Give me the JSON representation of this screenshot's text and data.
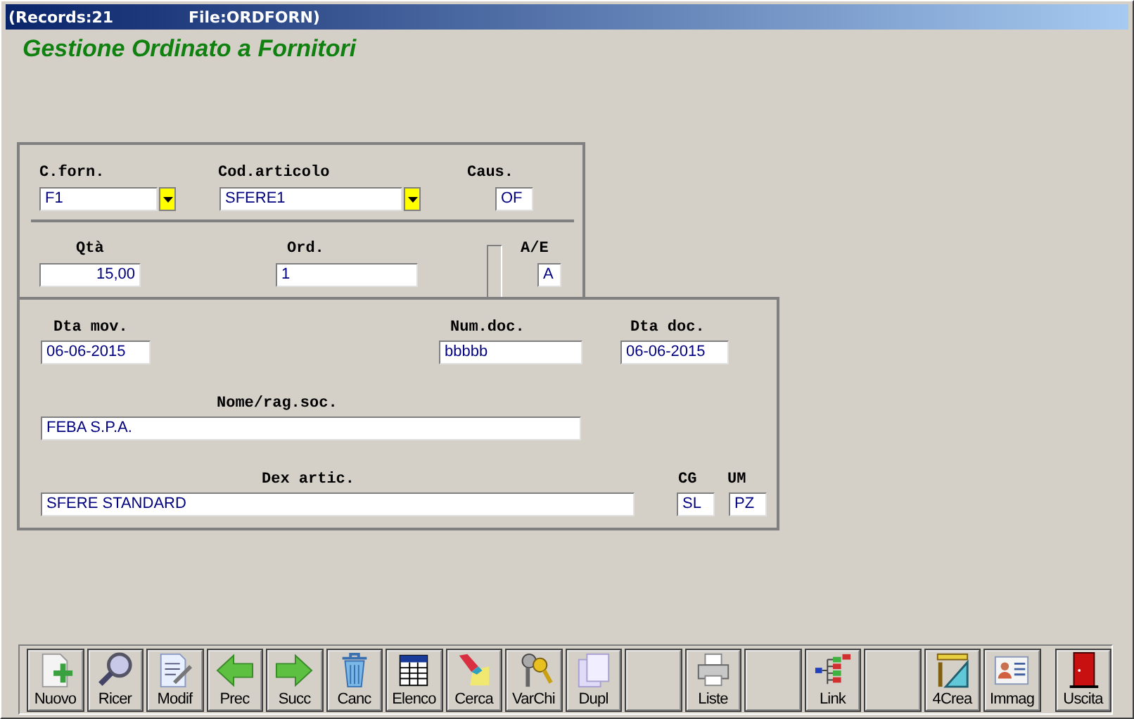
{
  "title_bar": {
    "records": "(Records:21",
    "file": "File:ORDFORN)"
  },
  "heading": "Gestione Ordinato a Fornitori",
  "panel_top": {
    "fields": [
      {
        "label": "C.forn.",
        "value": "F1",
        "dropdown": true
      },
      {
        "label": "Cod.articolo",
        "value": "SFERE1",
        "dropdown": true
      },
      {
        "label": "Caus.",
        "value": "OF"
      },
      {
        "label": "Qtà",
        "value": "15,00"
      },
      {
        "label": "Ord.",
        "value": "1"
      },
      {
        "label": "A/E",
        "value": "A"
      }
    ]
  },
  "panel_bottom": {
    "fields": [
      {
        "label": "Dta mov.",
        "value": "06-06-2015"
      },
      {
        "label": "Num.doc.",
        "value": "bbbbb"
      },
      {
        "label": "Dta doc.",
        "value": "06-06-2015"
      },
      {
        "label": "Nome/rag.soc.",
        "value": "FEBA S.P.A."
      },
      {
        "label": "Dex artic.",
        "value": "SFERE STANDARD"
      },
      {
        "label": "CG",
        "value": "SL"
      },
      {
        "label": "UM",
        "value": "PZ"
      }
    ]
  },
  "toolbar": [
    {
      "kind": "tool",
      "label": "Nuovo"
    },
    {
      "kind": "tool",
      "label": "Ricer"
    },
    {
      "kind": "tool",
      "label": "Modif"
    },
    {
      "kind": "tool",
      "label": "Prec"
    },
    {
      "kind": "tool",
      "label": "Succ"
    },
    {
      "kind": "tool",
      "label": "Canc"
    },
    {
      "kind": "tool",
      "label": "Elenco"
    },
    {
      "kind": "tool",
      "label": "Cerca"
    },
    {
      "kind": "tool",
      "label": "VarChi"
    },
    {
      "kind": "tool",
      "label": "Dupl"
    },
    {
      "kind": "empty"
    },
    {
      "kind": "tool",
      "label": "Liste"
    },
    {
      "kind": "empty"
    },
    {
      "kind": "tool",
      "label": "Link"
    },
    {
      "kind": "empty"
    },
    {
      "kind": "tool",
      "label": "4Crea"
    },
    {
      "kind": "tool",
      "label": "Immag"
    },
    {
      "kind": "tool",
      "label": "Uscita"
    }
  ]
}
